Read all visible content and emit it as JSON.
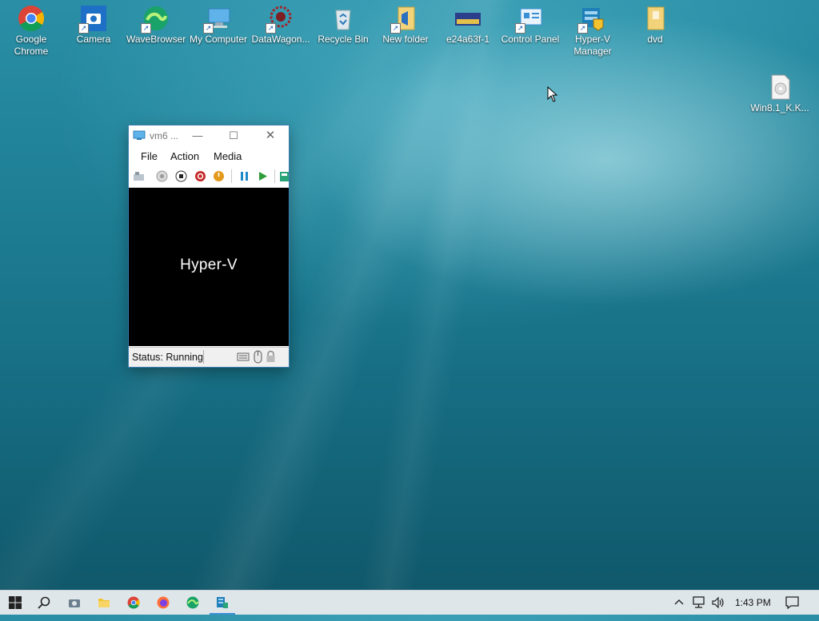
{
  "desktop": {
    "icons": [
      {
        "label": "Google Chrome",
        "icon": "chrome-icon"
      },
      {
        "label": "Camera",
        "icon": "camera-icon"
      },
      {
        "label": "WaveBrowser",
        "icon": "wavebrowser-icon"
      },
      {
        "label": "My Computer",
        "icon": "computer-icon"
      },
      {
        "label": "DataWagon...",
        "icon": "datawagon-icon"
      },
      {
        "label": "Recycle Bin",
        "icon": "recycle-bin-icon"
      },
      {
        "label": "New folder",
        "icon": "folder-icon"
      },
      {
        "label": "e24a63f-1",
        "icon": "image-file-icon"
      },
      {
        "label": "Control Panel",
        "icon": "control-panel-icon"
      },
      {
        "label": "Hyper-V Manager",
        "icon": "hyperv-manager-icon"
      },
      {
        "label": "dvd",
        "icon": "folder-icon"
      },
      {
        "label": "Win8.1_K.K...",
        "icon": "disc-file-icon"
      }
    ]
  },
  "vm_window": {
    "title": "vm6 ...",
    "menu": [
      "File",
      "Action",
      "Media"
    ],
    "screen_text": "Hyper-V",
    "status": "Status: Running"
  },
  "taskbar": {
    "time": "1:43 PM",
    "apps": [
      "start",
      "search",
      "camera",
      "file-explorer",
      "chrome",
      "firefox",
      "wavebrowser",
      "hyperv"
    ]
  },
  "colors": {
    "accent": "#3b8fd6",
    "chrome_red": "#db4437",
    "chrome_yellow": "#f4b400",
    "chrome_green": "#0f9d58",
    "stop_red": "#c62828",
    "start_green": "#2e9d3a"
  }
}
